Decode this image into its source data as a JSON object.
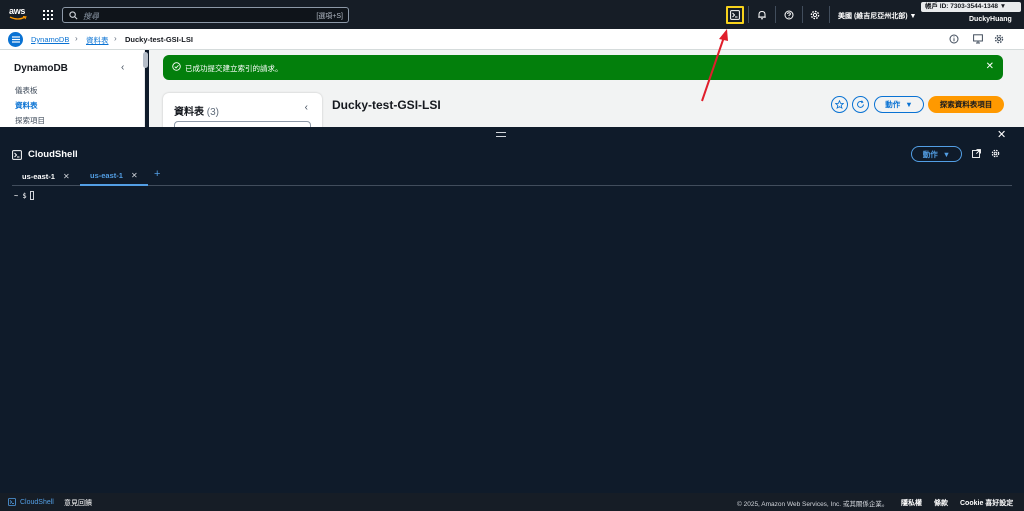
{
  "topnav": {
    "logo_text": "aws",
    "search_placeholder": "搜尋",
    "search_shortcut": "[選項+S]",
    "region": "美國 (維吉尼亞州北部) ▼",
    "account_badge": "帳戶 ID: 7303-3544-1348 ▼",
    "username": "DuckyHuang",
    "icons": [
      "cloudshell-icon",
      "bell-icon",
      "help-icon",
      "gear-icon"
    ]
  },
  "breadcrumb": {
    "items": [
      "DynamoDB",
      "資料表",
      "Ducky-test-GSI-LSI"
    ]
  },
  "sidenav": {
    "title": "DynamoDB",
    "items": [
      "儀表板",
      "資料表",
      "探索項目"
    ],
    "active_index": 1
  },
  "flash": {
    "message": "已成功提交建立索引的請求。"
  },
  "tables_panel": {
    "title": "資料表",
    "count": "(3)"
  },
  "page": {
    "title": "Ducky-test-GSI-LSI",
    "actions_label": "動作",
    "explore_label": "探索資料表項目"
  },
  "cloudshell": {
    "title": "CloudShell",
    "actions_label": "動作",
    "tabs": [
      {
        "label": "us-east-1"
      },
      {
        "label": "us-east-1"
      }
    ],
    "active_tab": 1,
    "prompt": "~ $"
  },
  "footer": {
    "cloudshell_label": "CloudShell",
    "feedback": "意見回饋",
    "copyright": "© 2025, Amazon Web Services, Inc. 或其關係企業。",
    "links": [
      "隱私權",
      "條款",
      "Cookie 喜好設定"
    ]
  },
  "colors": {
    "nav_bg": "#161d26",
    "link_blue": "#0972d3",
    "success_green": "#037f0c",
    "primary_orange": "#ff9900",
    "terminal_bg": "#0f1b2a",
    "highlight_yellow": "#f7d21c",
    "annotation_red": "#e01e2b"
  }
}
